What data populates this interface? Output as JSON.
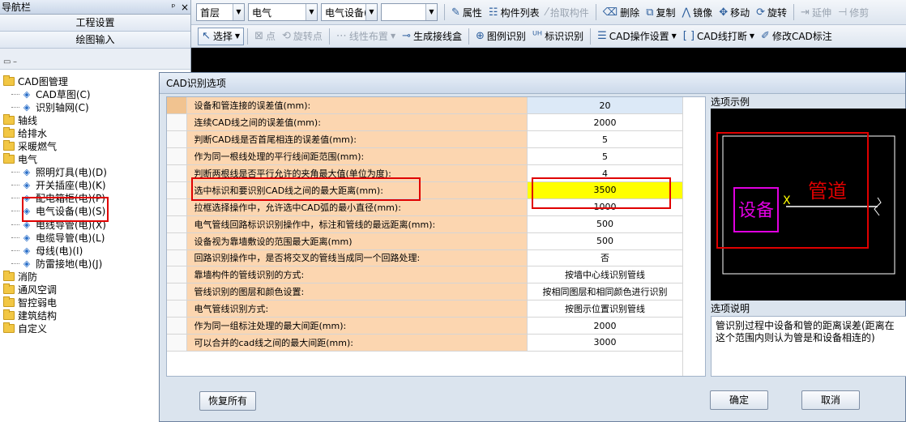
{
  "nav": {
    "title": "导航栏",
    "pin_glyph": "ᵖ",
    "close_glyph": "×",
    "btn_project": "工程设置",
    "btn_draw": "绘图输入",
    "tree": [
      {
        "label": "CAD图管理",
        "level": 0,
        "type": "folder"
      },
      {
        "label": "CAD草图(C)",
        "level": 1,
        "type": "leaf"
      },
      {
        "label": "识别轴网(C)",
        "level": 1,
        "type": "leaf"
      },
      {
        "label": "轴线",
        "level": 0,
        "type": "folder"
      },
      {
        "label": "给排水",
        "level": 0,
        "type": "folder"
      },
      {
        "label": "采暖燃气",
        "level": 0,
        "type": "folder"
      },
      {
        "label": "电气",
        "level": 0,
        "type": "folder"
      },
      {
        "label": "照明灯具(电)(D)",
        "level": 1,
        "type": "leaf"
      },
      {
        "label": "开关插座(电)(K)",
        "level": 1,
        "type": "leaf"
      },
      {
        "label": "配电箱柜(电)(P)",
        "level": 1,
        "type": "leaf"
      },
      {
        "label": "电气设备(电)(S)",
        "level": 1,
        "type": "leaf"
      },
      {
        "label": "电线导管(电)(X)",
        "level": 1,
        "type": "leaf"
      },
      {
        "label": "电缆导管(电)(L)",
        "level": 1,
        "type": "leaf"
      },
      {
        "label": "母线(电)(I)",
        "level": 1,
        "type": "leaf"
      },
      {
        "label": "防雷接地(电)(J)",
        "level": 1,
        "type": "leaf"
      },
      {
        "label": "消防",
        "level": 0,
        "type": "folder"
      },
      {
        "label": "通风空调",
        "level": 0,
        "type": "folder"
      },
      {
        "label": "智控弱电",
        "level": 0,
        "type": "folder"
      },
      {
        "label": "建筑结构",
        "level": 0,
        "type": "folder"
      },
      {
        "label": "自定义",
        "level": 0,
        "type": "folder"
      }
    ]
  },
  "toolbar1": {
    "floor": "首层",
    "discipline": "电气",
    "type": "电气设备(",
    "blank": "",
    "attr": "属性",
    "comp_list": "构件列表",
    "pick": "拾取构件",
    "delete": "删除",
    "copy": "复制",
    "mirror": "镜像",
    "move": "移动",
    "rotate": "旋转",
    "extend": "延伸",
    "trim": "修剪"
  },
  "toolbar2": {
    "select": "选择",
    "point": "点",
    "rotate_point": "旋转点",
    "line_layout": "线性布置",
    "gen_box": "生成接线盒",
    "legend_recog": "图例识别",
    "mark_recog": "标识识别",
    "cad_ops": "CAD操作设置",
    "cad_break": "CAD线打断",
    "modify_cad": "修改CAD标注"
  },
  "dialog": {
    "title": "CAD识别选项",
    "rows": [
      {
        "label": "设备和管连接的误差值(mm):",
        "value": "20"
      },
      {
        "label": "连续CAD线之间的误差值(mm):",
        "value": "2000"
      },
      {
        "label": "判断CAD线是否首尾相连的误差值(mm):",
        "value": "5"
      },
      {
        "label": "作为同一根线处理的平行线间距范围(mm):",
        "value": "5"
      },
      {
        "label": "判断两根线是否平行允许的夹角最大值(单位为度):",
        "value": "4"
      },
      {
        "label": "选中标识和要识别CAD线之间的最大距离(mm):",
        "value": "3500"
      },
      {
        "label": "拉框选择操作中，允许选中CAD弧的最小直径(mm):",
        "value": "1000"
      },
      {
        "label": "电气管线回路标识识别操作中，标注和管线的最远距离(mm):",
        "value": "500"
      },
      {
        "label": "设备视为靠墙敷设的范围最大距离(mm)",
        "value": "500"
      },
      {
        "label": "回路识别操作中，是否将交叉的管线当成同一个回路处理:",
        "value": "否"
      },
      {
        "label": "靠墙构件的管线识别的方式:",
        "value": "按墙中心线识别管线"
      },
      {
        "label": "管线识别的图层和颜色设置:",
        "value": "按相同图层和相同颜色进行识别"
      },
      {
        "label": "电气管线识别方式:",
        "value": "按图示位置识别管线"
      },
      {
        "label": "作为同一组标注处理的最大间距(mm):",
        "value": "2000"
      },
      {
        "label": "可以合并的cad线之间的最大间距(mm):",
        "value": "3000"
      }
    ],
    "example_title": "选项示例",
    "example_device": "设备",
    "example_x": "X",
    "example_pipe": "管道",
    "explain_title": "选项说明",
    "explain_text": "管识别过程中设备和管的距离误差(距离在这个范围内则认为管是和设备相连的)",
    "restore_btn": "恢复所有",
    "ok_btn": "确定",
    "cancel_btn": "取消"
  },
  "colors": {
    "highlight": "#ffff00",
    "annotation_red": "#e00000",
    "label_cell": "#fcd6b0"
  }
}
